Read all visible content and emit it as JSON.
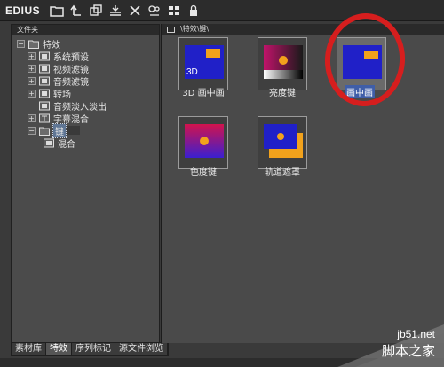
{
  "app": {
    "name": "EDIUS"
  },
  "toolbar": {
    "icons": [
      "folder-icon",
      "up-arrow-icon",
      "copy-layers-icon",
      "align-icon",
      "delete-icon",
      "effect-icon",
      "view-icon",
      "lock-icon"
    ]
  },
  "left_panel": {
    "header": "文件夹",
    "tree": [
      {
        "label": "特效",
        "level": 0,
        "expanded": true
      },
      {
        "label": "系统预设",
        "level": 1
      },
      {
        "label": "视频滤镜",
        "level": 1
      },
      {
        "label": "音频滤镜",
        "level": 1
      },
      {
        "label": "转场",
        "level": 1
      },
      {
        "label": "音频淡入淡出",
        "level": 1
      },
      {
        "label": "字幕混合",
        "level": 1
      },
      {
        "label": "键",
        "level": 1,
        "selected": true,
        "expanded": true
      },
      {
        "label": "混合",
        "level": 2
      }
    ],
    "tabs": [
      "素材库",
      "特效",
      "序列标记",
      "源文件浏览"
    ],
    "active_tab": "特效"
  },
  "right_panel": {
    "breadcrumb": "\\特效\\键\\",
    "items": [
      {
        "label": "3D 画中画",
        "thumb_text": "3D"
      },
      {
        "label": "亮度键"
      },
      {
        "label": "画中画",
        "selected": true
      },
      {
        "label": "色度键"
      },
      {
        "label": "轨道遮罩"
      }
    ]
  },
  "watermark": {
    "site": "jb51.net",
    "name": "脚本之家"
  },
  "colors": {
    "accent_selection": "#3f5ea8",
    "annotation_circle": "#d61e1e",
    "thumb_blue": "#2b2bd0",
    "thumb_orange": "#f2a21c"
  }
}
